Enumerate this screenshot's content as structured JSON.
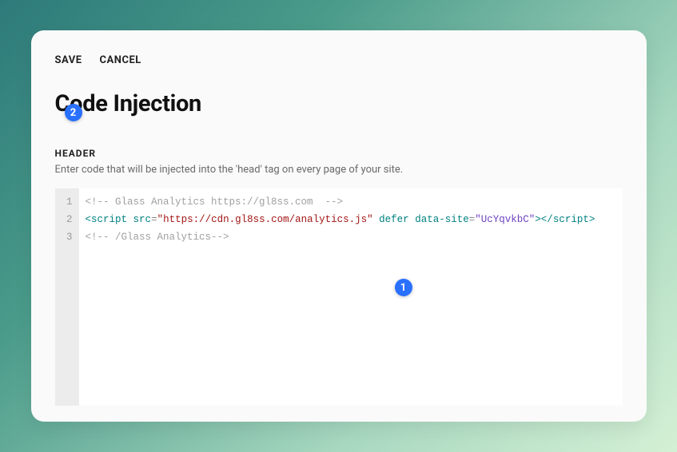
{
  "actions": {
    "save": "SAVE",
    "cancel": "CANCEL"
  },
  "title": "Code Injection",
  "section": {
    "label": "HEADER",
    "desc": "Enter code that will be injected into the 'head' tag on every page of your site."
  },
  "code": {
    "lines": [
      "1",
      "2",
      "3"
    ],
    "l1": "<!-- Glass Analytics https://gl8ss.com  -->",
    "l2_tag_open": "<",
    "l2_tag": "script",
    "l2_sp1": " ",
    "l2_attr1": "src",
    "l2_eq1": "=",
    "l2_q1a": "\"",
    "l2_val1": "https://cdn.gl8ss.com/analytics.js",
    "l2_q1b": "\"",
    "l2_sp2": " ",
    "l2_attr2": "defer",
    "l2_sp3": " ",
    "l2_attr3": "data-site",
    "l2_eq2": "=",
    "l2_q2a": "\"",
    "l2_val2": "UcYqvkbC",
    "l2_q2b": "\"",
    "l2_tag_close": ">",
    "l2_close_open": "</",
    "l2_close_tag": "script",
    "l2_close_end": ">",
    "l3": "<!-- /Glass Analytics-->"
  },
  "badges": {
    "one": "1",
    "two": "2"
  }
}
